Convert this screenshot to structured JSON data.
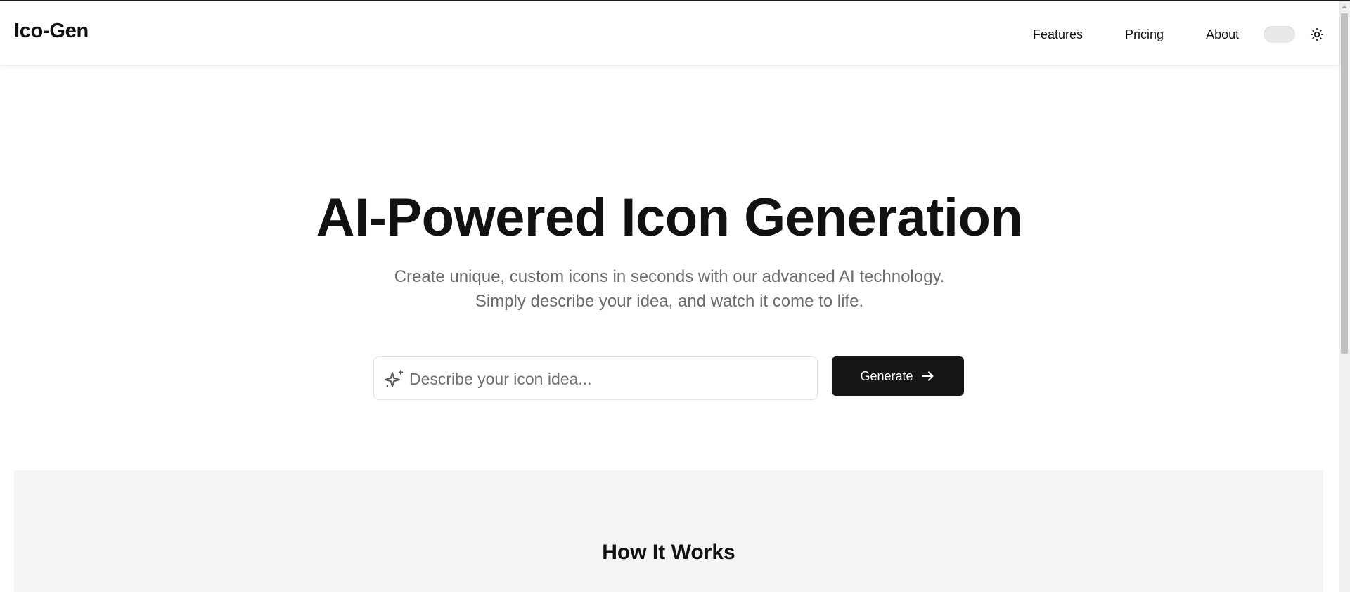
{
  "header": {
    "brand": "Ico-Gen",
    "nav": [
      "Features",
      "Pricing",
      "About"
    ],
    "theme_toggle": {
      "state": "off"
    },
    "theme_icon": "sun-icon"
  },
  "hero": {
    "title": "AI-Powered Icon Generation",
    "subtitle_line1": "Create unique, custom icons in seconds with our advanced AI technology.",
    "subtitle_line2": "Simply describe your idea, and watch it come to life.",
    "search": {
      "placeholder": "Describe your icon idea...",
      "value": "",
      "icon": "sparkle-icon"
    },
    "generate_button": {
      "label": "Generate",
      "icon": "arrow-right-icon"
    }
  },
  "how_it_works": {
    "title": "How It Works"
  },
  "colors": {
    "button_bg": "#161616",
    "section_bg": "#f3f4f6",
    "subtitle_text": "#6b6b6b"
  }
}
